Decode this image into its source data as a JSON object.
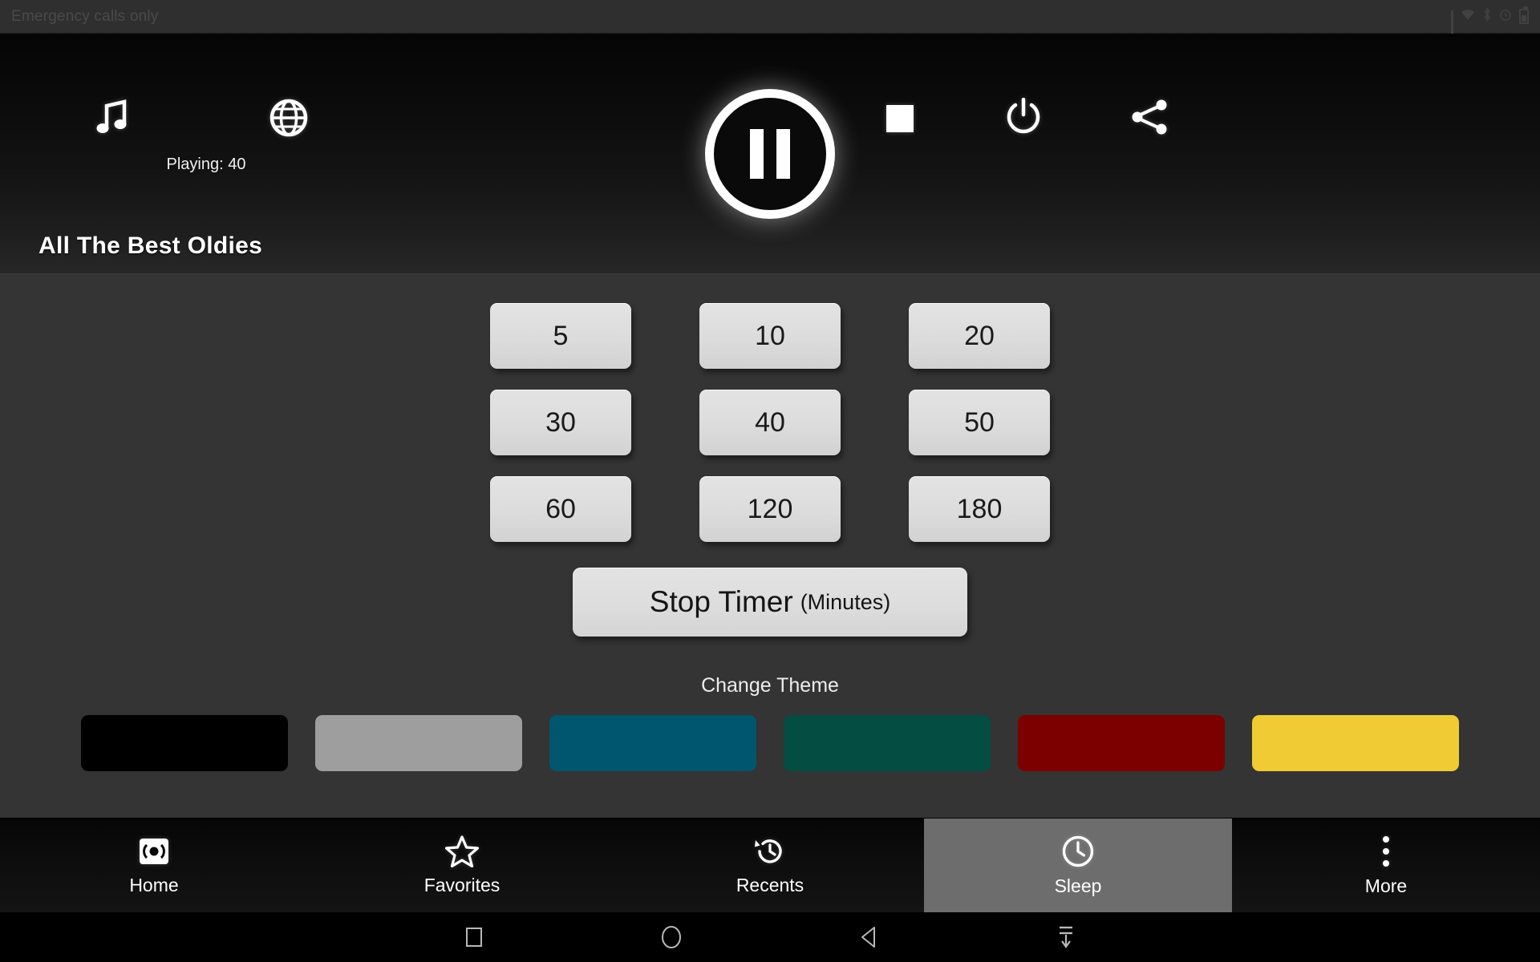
{
  "status_bar": {
    "carrier_text": "Emergency calls only",
    "indicators": [
      "signal-bars",
      "wifi",
      "bluetooth",
      "alarm",
      "battery"
    ],
    "battery_text": ""
  },
  "player": {
    "music_icon": "music-note-icon",
    "globe_icon": "globe-icon",
    "playing_label": "Playing: 40",
    "transport_state": "pause",
    "pause_icon": "pause-icon",
    "stop_icon": "stop-square-icon",
    "power_icon": "power-icon",
    "share_icon": "share-icon",
    "station_title": "All The Best Oldies"
  },
  "sleep": {
    "timer_options": [
      "5",
      "10",
      "20",
      "30",
      "40",
      "50",
      "60",
      "120",
      "180"
    ],
    "stop_timer": {
      "main_label": "Stop Timer",
      "unit_label": "(Minutes)"
    },
    "theme": {
      "heading": "Change Theme",
      "swatches": [
        {
          "name": "black",
          "color": "#000000"
        },
        {
          "name": "grey",
          "color": "#9e9e9e"
        },
        {
          "name": "teal-blue",
          "color": "#00566e"
        },
        {
          "name": "dark-green",
          "color": "#034d43"
        },
        {
          "name": "dark-red",
          "color": "#7d0000"
        },
        {
          "name": "yellow",
          "color": "#f0cb33"
        }
      ]
    }
  },
  "tabs": [
    {
      "label": "Home",
      "icon": "broadcast-icon",
      "active": false
    },
    {
      "label": "Favorites",
      "icon": "star-icon",
      "active": false
    },
    {
      "label": "Recents",
      "icon": "history-icon",
      "active": false
    },
    {
      "label": "Sleep",
      "icon": "clock-icon",
      "active": true
    },
    {
      "label": "More",
      "icon": "overflow-dots-icon",
      "active": false
    }
  ],
  "android_nav": [
    {
      "name": "recents-button",
      "icon": "square-icon"
    },
    {
      "name": "home-button",
      "icon": "circle-icon"
    },
    {
      "name": "back-button",
      "icon": "triangle-left-icon"
    },
    {
      "name": "hide-keyboard-button",
      "icon": "arrow-down-bar-icon"
    }
  ]
}
